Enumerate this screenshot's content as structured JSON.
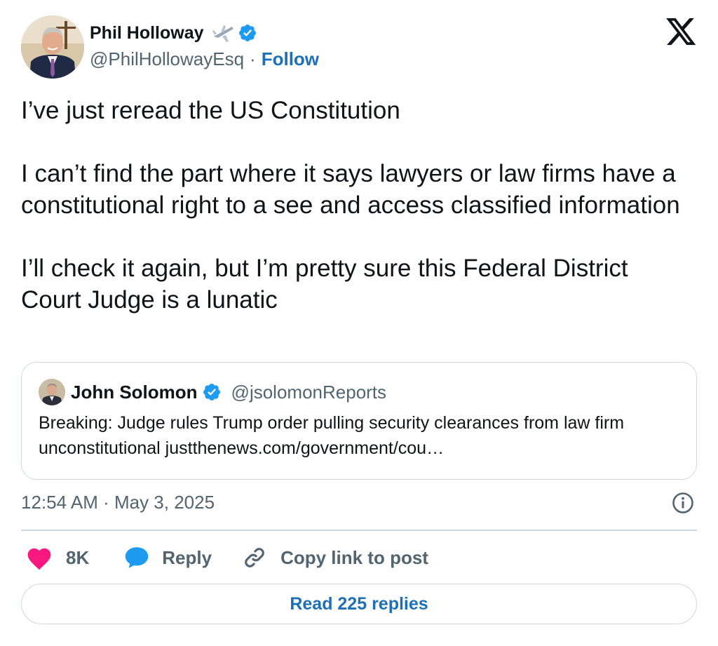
{
  "author": {
    "name": "Phil Holloway",
    "handle": "@PhilHollowayEsq",
    "separator": "·",
    "follow_label": "Follow",
    "emoji_icon": "airplane-icon",
    "verified_color": "#1d9bf0"
  },
  "tweet": {
    "text": "I’ve just reread the US Constitution\n\nI can’t find the part where it says lawyers or law firms have a constitutional right to a see and access classified information\n\nI’ll check it again, but I’m pretty sure this Federal District Court Judge is a lunatic",
    "timestamp": "12:54 AM · May 3, 2025"
  },
  "quoted": {
    "name": "John Solomon",
    "handle": "@jsolomonReports",
    "text": "Breaking: Judge rules Trump order pulling security clearances from law firm unconstitutional justthenews.com/government/cou…"
  },
  "actions": {
    "like_count": "8K",
    "reply_label": "Reply",
    "copy_label": "Copy link to post",
    "read_replies_label": "Read 225 replies"
  },
  "colors": {
    "like": "#f91880",
    "reply": "#1d9bf0",
    "link_blue": "#1d6fb7",
    "muted": "#536471",
    "border": "#cfd9de"
  }
}
